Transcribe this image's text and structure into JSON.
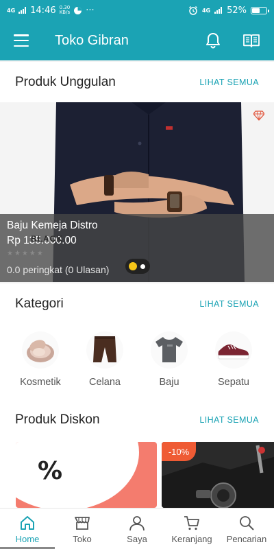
{
  "status": {
    "time": "14:46",
    "network_left": "4G",
    "speed_top": "0.30",
    "speed_unit": "KB/s",
    "more": "···",
    "network_right": "4G",
    "battery": "52%"
  },
  "app": {
    "title": "Toko Gibran"
  },
  "featured_section": {
    "title": "Produk Unggulan",
    "see_all": "LIHAT SEMUA"
  },
  "featured_product": {
    "name": "Baju Kemeja Distro",
    "price": "Rp 135.000.00",
    "rating_text": "0.0 peringkat (0 Ulasan)",
    "stars": "★★★★★",
    "overlay_text": "BLACK"
  },
  "category_section": {
    "title": "Kategori",
    "see_all": "LIHAT SEMUA"
  },
  "categories": [
    {
      "label": "Kosmetik",
      "icon": "cosmetic-compact-icon"
    },
    {
      "label": "Celana",
      "icon": "pants-icon"
    },
    {
      "label": "Baju",
      "icon": "tshirt-icon"
    },
    {
      "label": "Sepatu",
      "icon": "shoe-icon"
    }
  ],
  "discount_section": {
    "title": "Produk Diskon",
    "see_all": "LIHAT SEMUA"
  },
  "discount_cards": [
    {
      "symbol": "%"
    },
    {
      "badge": "-10%"
    }
  ],
  "bottom_nav": [
    {
      "label": "Home",
      "icon": "home-icon",
      "active": true
    },
    {
      "label": "Toko",
      "icon": "store-icon"
    },
    {
      "label": "Saya",
      "icon": "user-icon"
    },
    {
      "label": "Keranjang",
      "icon": "cart-icon"
    },
    {
      "label": "Pencarian",
      "icon": "search-icon"
    }
  ],
  "colors": {
    "primary": "#1ba3b4",
    "accent_yellow": "#f5c518",
    "discount_coral": "#f47c6e",
    "badge_orange": "#ef5b34"
  }
}
